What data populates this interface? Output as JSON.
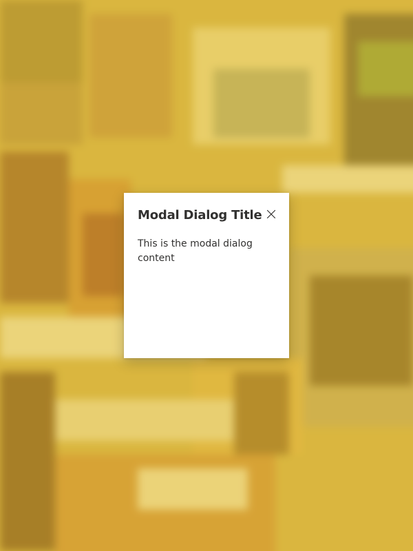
{
  "modal": {
    "title": "Modal Dialog Title",
    "close_icon": "close-icon",
    "content": "This is the modal dialog content"
  },
  "colors": {
    "overlay_tint": "#e8c43a",
    "modal_background": "#ffffff",
    "text": "#323130"
  }
}
